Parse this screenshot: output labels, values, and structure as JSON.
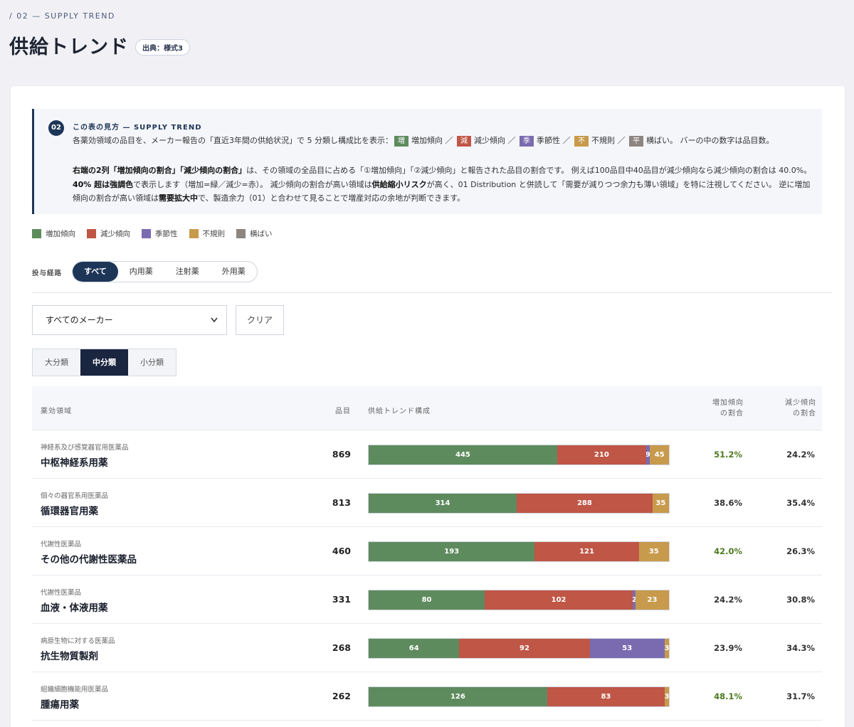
{
  "header": {
    "eyebrow": "/ 02 — SUPPLY TREND",
    "title": "供給トレンド",
    "source_badge": "出典：様式3"
  },
  "info": {
    "number": "02",
    "title": "この表の見方 — SUPPLY TREND",
    "line1_prefix": "各薬効領域の品目を、メーカー報告の「直近3年間の供給状況」で 5 分類し構成比を表示：",
    "line1_suffix": "バーの中の数字は品目数。",
    "para_part1_bold": "右端の2列「増加傾向の割合」「減少傾向の割合」",
    "para_part2": "は、その領域の全品目に占める「①増加傾向」「②減少傾向」と報告された品目の割合です。 例えば100品目中40品目が減少傾向なら減少傾向の割合は 40.0%。 ",
    "para_part3_bold": "40% 超は強調色",
    "para_part4": "で表示します（増加=緑／減少=赤）。 減少傾向の割合が高い領域は",
    "para_part5_bold": "供給縮小リスク",
    "para_part6": "が高く、01 Distribution と併読して「需要が減りつつ余力も薄い領域」を特に注視してください。 逆に増加傾向の割合が高い領域は",
    "para_part7_bold": "需要拡大中",
    "para_part8": "で、製造余力（01）と合わせて見ることで増産対応の余地が判断できます。"
  },
  "categories": [
    {
      "key": "inc",
      "chip": "増",
      "label": "増加傾向",
      "color": "#5e8b5e"
    },
    {
      "key": "dec",
      "chip": "減",
      "label": "減少傾向",
      "color": "#bf5646"
    },
    {
      "key": "sea",
      "chip": "季",
      "label": "季節性",
      "color": "#7a6bb0"
    },
    {
      "key": "irr",
      "chip": "不",
      "label": "不規則",
      "color": "#c89a4c"
    },
    {
      "key": "flat",
      "chip": "平",
      "label": "横ばい",
      "color": "#8c8580"
    }
  ],
  "filters": {
    "route_label": "投与経路",
    "routes": [
      "すべて",
      "内用薬",
      "注射薬",
      "外用薬"
    ],
    "route_selected": 0,
    "maker_selected": "すべてのメーカー",
    "clear_label": "クリア",
    "levels": [
      "大分類",
      "中分類",
      "小分類"
    ],
    "level_selected": 1
  },
  "table": {
    "columns": {
      "area": "薬効領域",
      "count": "品目",
      "trend": "供給トレンド構成",
      "inc_share_l1": "増加傾向",
      "inc_share_l2": "の割合",
      "dec_share_l1": "減少傾向",
      "dec_share_l2": "の割合"
    },
    "rows": [
      {
        "category": "神経系及び感覚器官用医薬品",
        "name": "中枢神経系用薬",
        "count": "869",
        "segments": [
          445,
          210,
          9,
          45,
          0
        ],
        "inc_share": "51.2%",
        "dec_share": "24.2%",
        "inc_highlight": true
      },
      {
        "category": "個々の器官系用医薬品",
        "name": "循環器官用薬",
        "count": "813",
        "segments": [
          314,
          288,
          0,
          35,
          0
        ],
        "inc_share": "38.6%",
        "dec_share": "35.4%",
        "inc_highlight": false
      },
      {
        "category": "代謝性医薬品",
        "name": "その他の代謝性医薬品",
        "count": "460",
        "segments": [
          193,
          121,
          0,
          35,
          0
        ],
        "inc_share": "42.0%",
        "dec_share": "26.3%",
        "inc_highlight": true
      },
      {
        "category": "代謝性医薬品",
        "name": "血液・体液用薬",
        "count": "331",
        "segments": [
          80,
          102,
          2,
          23,
          0
        ],
        "inc_share": "24.2%",
        "dec_share": "30.8%",
        "inc_highlight": false
      },
      {
        "category": "病原生物に対する医薬品",
        "name": "抗生物質製剤",
        "count": "268",
        "segments": [
          64,
          92,
          53,
          3,
          0
        ],
        "inc_share": "23.9%",
        "dec_share": "34.3%",
        "inc_highlight": false
      },
      {
        "category": "組織細胞機能用医薬品",
        "name": "腫瘍用薬",
        "count": "262",
        "segments": [
          126,
          83,
          0,
          3,
          0
        ],
        "inc_share": "48.1%",
        "dec_share": "31.7%",
        "inc_highlight": true
      }
    ]
  },
  "colors": {
    "highlight_inc": "#4d7a1f",
    "normal_share": "#333333",
    "accent": "#1d3557"
  }
}
